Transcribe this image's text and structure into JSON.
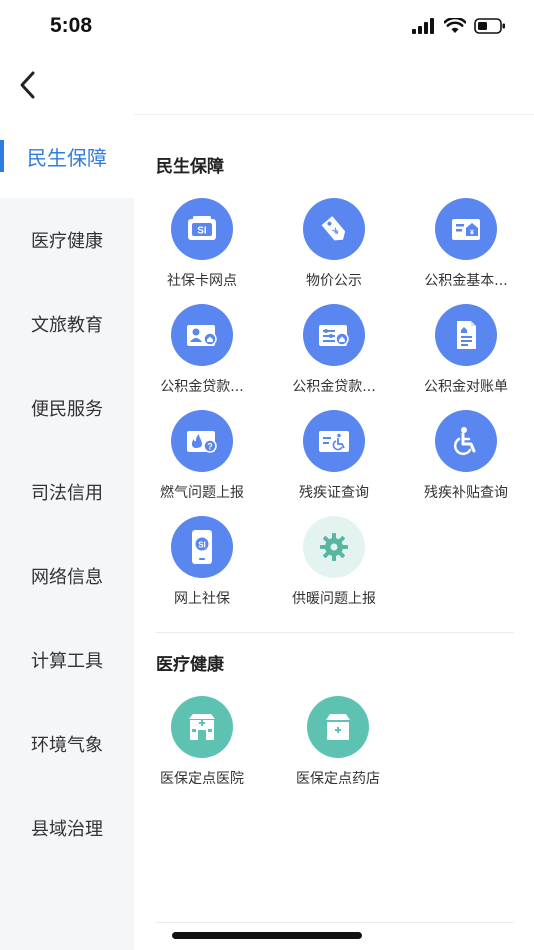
{
  "status_bar": {
    "time": "5:08"
  },
  "sidebar": {
    "items": [
      {
        "label": "民生保障",
        "active": true
      },
      {
        "label": "医疗健康",
        "active": false
      },
      {
        "label": "文旅教育",
        "active": false
      },
      {
        "label": "便民服务",
        "active": false
      },
      {
        "label": "司法信用",
        "active": false
      },
      {
        "label": "网络信息",
        "active": false
      },
      {
        "label": "计算工具",
        "active": false
      },
      {
        "label": "环境气象",
        "active": false
      },
      {
        "label": "县域治理",
        "active": false
      }
    ]
  },
  "sections": [
    {
      "title": "民生保障",
      "items": [
        {
          "label": "社保卡网点",
          "icon": "social-security-card-icon"
        },
        {
          "label": "物价公示",
          "icon": "price-tag-icon"
        },
        {
          "label": "公积金基本...",
          "icon": "fund-info-card-icon"
        },
        {
          "label": "公积金贷款...",
          "icon": "fund-loan-person-icon"
        },
        {
          "label": "公积金贷款...",
          "icon": "fund-loan-settings-icon"
        },
        {
          "label": "公积金对账单",
          "icon": "fund-statement-icon"
        },
        {
          "label": "燃气问题上报",
          "icon": "gas-question-icon"
        },
        {
          "label": "残疾证查询",
          "icon": "disability-card-icon"
        },
        {
          "label": "残疾补贴查询",
          "icon": "wheelchair-icon"
        },
        {
          "label": "网上社保",
          "icon": "mobile-social-security-icon"
        },
        {
          "label": "供暖问题上报",
          "icon": "gear-icon"
        }
      ]
    },
    {
      "title": "医疗健康",
      "items": [
        {
          "label": "医保定点医院",
          "icon": "hospital-icon"
        },
        {
          "label": "医保定点药店",
          "icon": "pharmacy-icon"
        }
      ]
    }
  ],
  "colors": {
    "accent": "#2f7de1",
    "icon_blue": "#5a86ef",
    "icon_teal": "#5ec2b3",
    "icon_light": "#e3f4f0"
  }
}
